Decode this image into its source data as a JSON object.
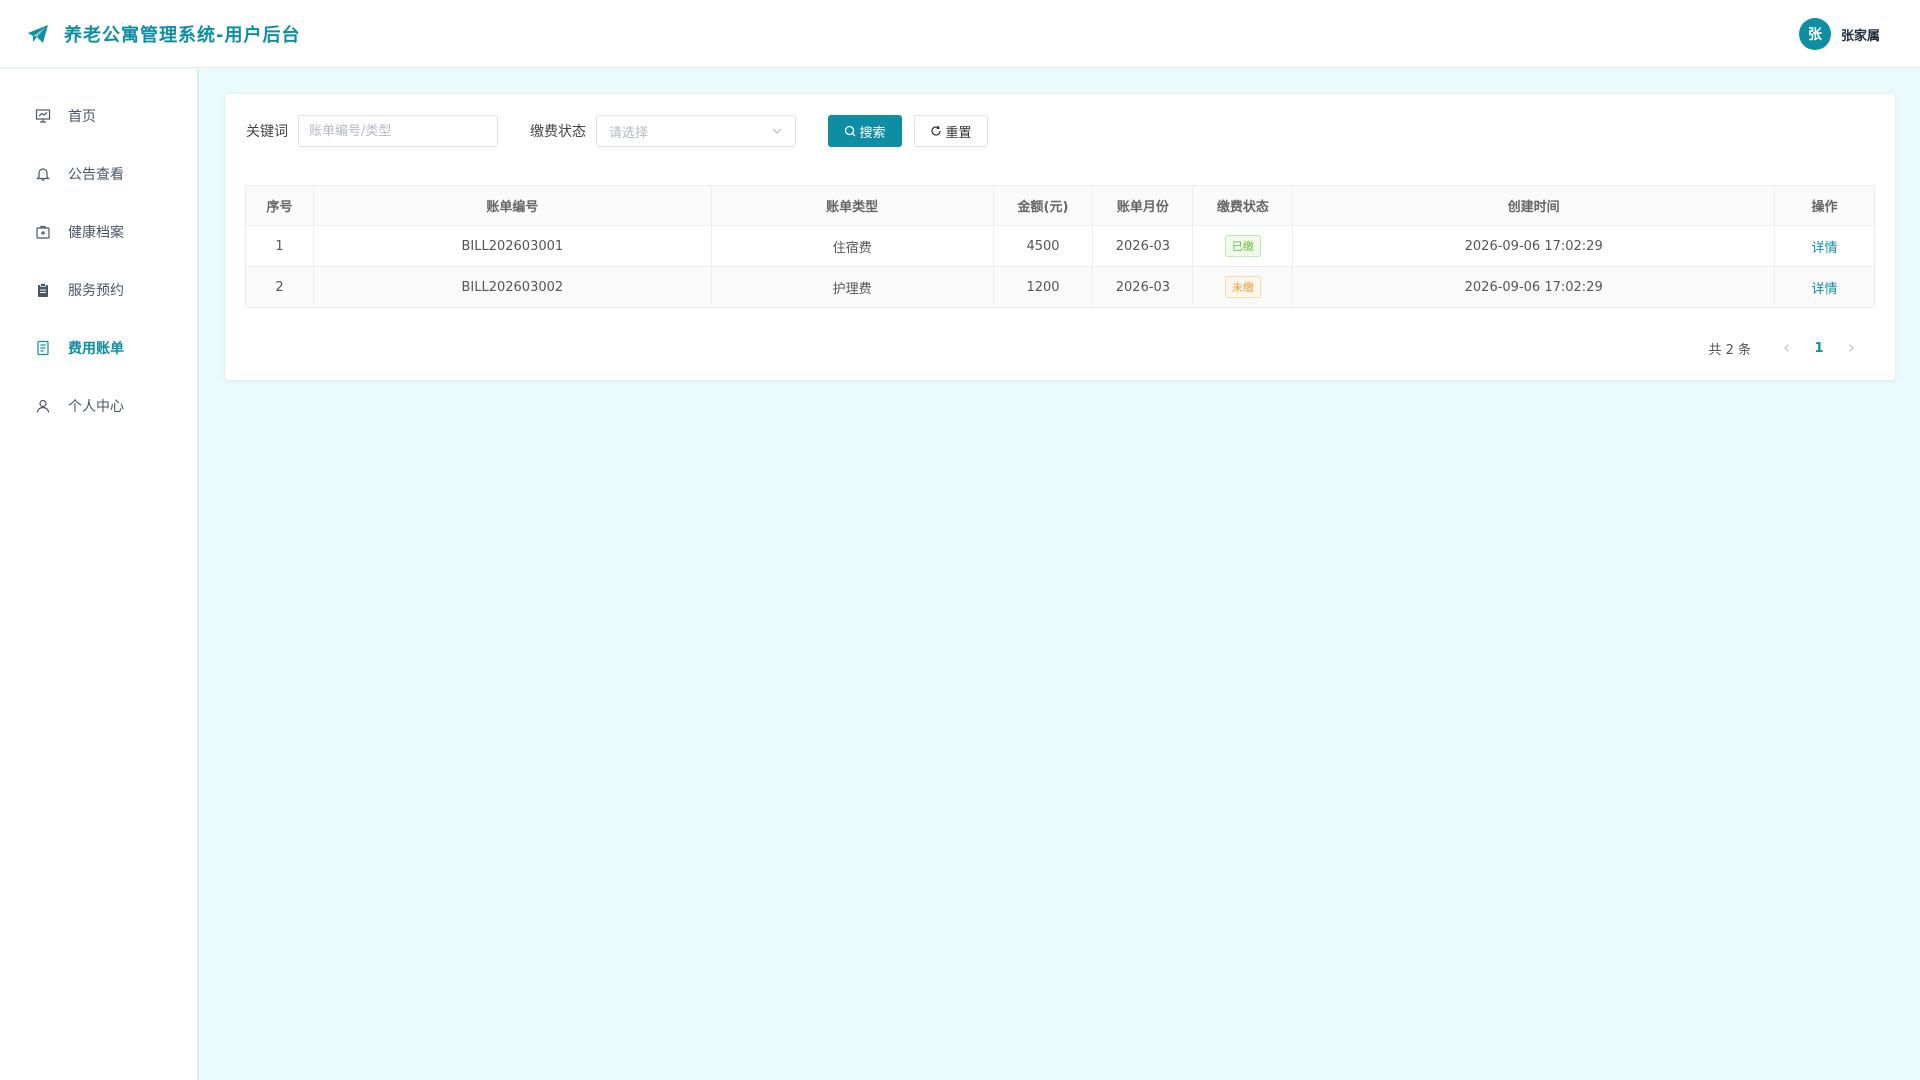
{
  "header": {
    "title": "养老公寓管理系统-用户后台",
    "user_avatar_text": "张",
    "user_name": "张家属"
  },
  "sidebar": {
    "items": [
      {
        "label": "首页",
        "icon": "presentation-chart-icon",
        "active": false
      },
      {
        "label": "公告查看",
        "icon": "bell-icon",
        "active": false
      },
      {
        "label": "健康档案",
        "icon": "first-aid-kit-icon",
        "active": false
      },
      {
        "label": "服务预约",
        "icon": "clipboard-icon",
        "active": false
      },
      {
        "label": "费用账单",
        "icon": "document-icon",
        "active": true
      },
      {
        "label": "个人中心",
        "icon": "user-icon",
        "active": false
      }
    ]
  },
  "filters": {
    "keyword_label": "关键词",
    "keyword_value": "",
    "keyword_placeholder": "账单编号/类型",
    "status_label": "缴费状态",
    "status_placeholder": "请选择",
    "search_label": "搜索",
    "reset_label": "重置"
  },
  "table": {
    "headers": [
      "序号",
      "账单编号",
      "账单类型",
      "金额(元)",
      "账单月份",
      "缴费状态",
      "创建时间",
      "操作"
    ],
    "rows": [
      {
        "index": "1",
        "bill_no": "BILL202603001",
        "type": "住宿费",
        "amount": "4500",
        "month": "2026-03",
        "status": "已缴",
        "created": "2026-09-06 17:02:29",
        "action": "详情"
      },
      {
        "index": "2",
        "bill_no": "BILL202603002",
        "type": "护理费",
        "amount": "1200",
        "month": "2026-03",
        "status": "未缴",
        "created": "2026-09-06 17:02:29",
        "action": "详情"
      }
    ]
  },
  "pagination": {
    "total_text": "共 2 条",
    "current_page": "1"
  },
  "colors": {
    "accent": "#0e8ea3",
    "paid_tag": "#67c23a",
    "unpaid_tag": "#e6a23c",
    "background": "#e9fbfd"
  }
}
